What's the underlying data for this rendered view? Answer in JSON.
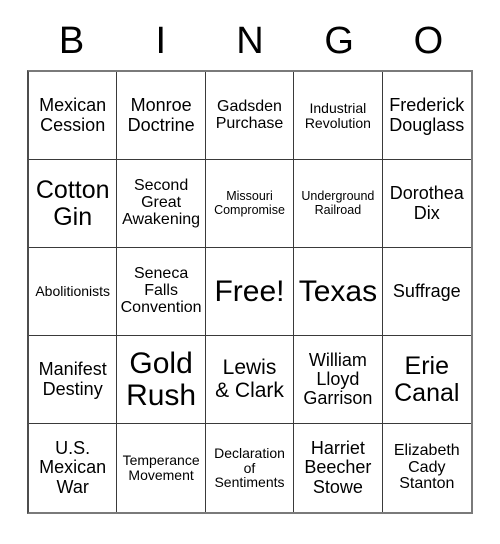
{
  "header": {
    "letters": [
      "B",
      "I",
      "N",
      "G",
      "O"
    ]
  },
  "grid": {
    "rows": 5,
    "columns": 5,
    "cells": [
      {
        "text": "Mexican\nCession",
        "size": "ml"
      },
      {
        "text": "Monroe\nDoctrine",
        "size": "ml"
      },
      {
        "text": "Gadsden\nPurchase",
        "size": "m"
      },
      {
        "text": "Industrial\nRevolution",
        "size": "s"
      },
      {
        "text": "Frederick\nDouglass",
        "size": "ml"
      },
      {
        "text": "Cotton\nGin",
        "size": "xl"
      },
      {
        "text": "Second\nGreat\nAwakening",
        "size": "m"
      },
      {
        "text": "Missouri\nCompromise",
        "size": "xs"
      },
      {
        "text": "Underground\nRailroad",
        "size": "xs"
      },
      {
        "text": "Dorothea\nDix",
        "size": "ml"
      },
      {
        "text": "Abolitionists",
        "size": "s"
      },
      {
        "text": "Seneca\nFalls\nConvention",
        "size": "m"
      },
      {
        "text": "Free!",
        "size": "xxl"
      },
      {
        "text": "Texas",
        "size": "xxl"
      },
      {
        "text": "Suffrage",
        "size": "ml"
      },
      {
        "text": "Manifest\nDestiny",
        "size": "ml"
      },
      {
        "text": "Gold\nRush",
        "size": "xxl"
      },
      {
        "text": "Lewis\n& Clark",
        "size": "l"
      },
      {
        "text": "William\nLloyd\nGarrison",
        "size": "ml"
      },
      {
        "text": "Erie\nCanal",
        "size": "xl"
      },
      {
        "text": "U.S.\nMexican\nWar",
        "size": "ml"
      },
      {
        "text": "Temperance\nMovement",
        "size": "s"
      },
      {
        "text": "Declaration\nof\nSentiments",
        "size": "s"
      },
      {
        "text": "Harriet\nBeecher\nStowe",
        "size": "ml"
      },
      {
        "text": "Elizabeth\nCady\nStanton",
        "size": "m"
      }
    ]
  },
  "colors": {
    "background": "#ffffff",
    "text": "#000000",
    "grid_line": "#3a3a3a",
    "outer_border": "#7a7a7a"
  }
}
